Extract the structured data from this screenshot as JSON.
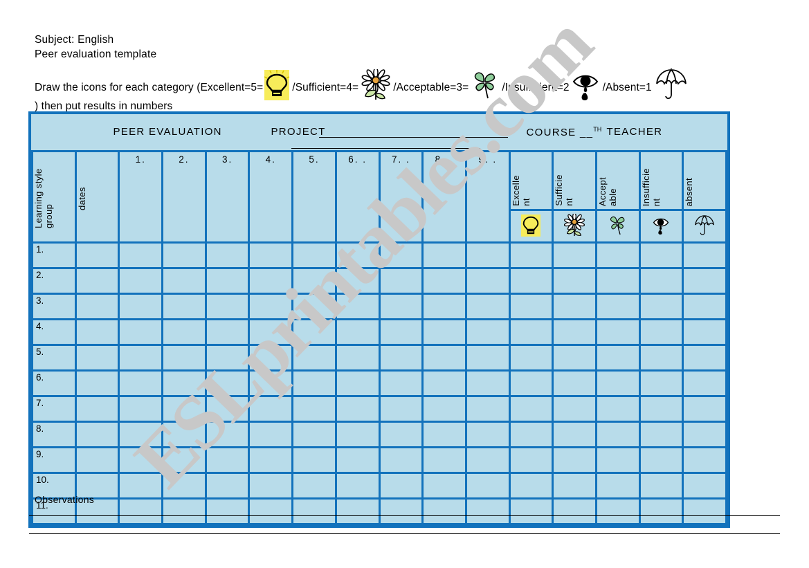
{
  "header": {
    "subject_line": "Subject: English",
    "template_line": "Peer evaluation template",
    "instruction_start": "Draw the icons for each category (Excellent=5=",
    "instruction_seg2": "/Sufficient=4=",
    "instruction_seg3": "/Acceptable=3=",
    "instruction_seg4": "/Insufficient=2",
    "instruction_seg5": "/Absent=1",
    "instruction_end": ") then put results in numbers"
  },
  "banner": {
    "title": "PEER EVALUATION",
    "project_label": "PROJECT",
    "course_label": "COURSE __",
    "course_sup": "TH",
    "teacher_label": "TEACHER"
  },
  "grid": {
    "corner_label_1": "Learning style\ngroup",
    "corner_label_2": "dates",
    "number_columns": [
      "1.",
      "2.",
      "3.",
      "4.",
      "5.",
      "6.  .",
      "7.  .",
      "8.  .",
      "9.  ."
    ],
    "rating_columns": [
      {
        "label": "Excelle\nnt",
        "icon": "lightbulb-icon"
      },
      {
        "label": "Sufficie\nnt",
        "icon": "daisy-icon"
      },
      {
        "label": "Accept\nable",
        "icon": "clover-icon"
      },
      {
        "label": "Insufficie\nnt",
        "icon": "crying-eye-icon"
      },
      {
        "label": "absent",
        "icon": "umbrella-icon"
      }
    ],
    "rows": [
      "1.",
      "2.",
      "3.",
      "4.",
      "5.",
      "6.",
      "7.",
      "8.",
      "9.",
      "10.",
      "11."
    ]
  },
  "footer": {
    "observations_label": "Observations"
  },
  "watermark": {
    "text": "ESLprintables.com"
  },
  "colors": {
    "grid_border": "#1272bc",
    "grid_fill": "#b8dcea",
    "bulb_yellow": "#f7ec5a",
    "clover_green": "#8fce9b",
    "watermark_gray": "#c8c8c8"
  }
}
